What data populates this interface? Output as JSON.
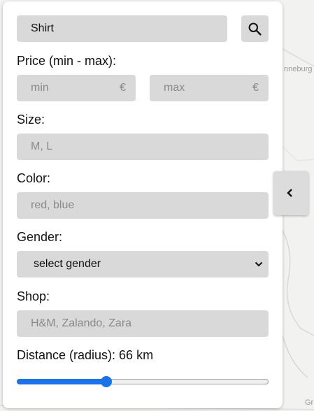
{
  "map": {
    "labels": [
      "nneburg",
      "Gr"
    ]
  },
  "search": {
    "value": "Shirt",
    "button_icon": "search-icon"
  },
  "price": {
    "label": "Price (min - max):",
    "min_placeholder": "min",
    "max_placeholder": "max",
    "currency": "€"
  },
  "size": {
    "label": "Size:",
    "placeholder": "M, L"
  },
  "color": {
    "label": "Color:",
    "placeholder": "red, blue"
  },
  "gender": {
    "label": "Gender:",
    "selected": "select gender"
  },
  "shop": {
    "label": "Shop:",
    "placeholder": "H&M, Zalando, Zara"
  },
  "distance": {
    "label": "Distance (radius): 66 km",
    "slider_fraction": 0.355
  },
  "collapse_button": {
    "icon": "chevron-left-icon"
  },
  "colors": {
    "accent": "#1a73e8",
    "field_bg": "#d9d9d9"
  }
}
